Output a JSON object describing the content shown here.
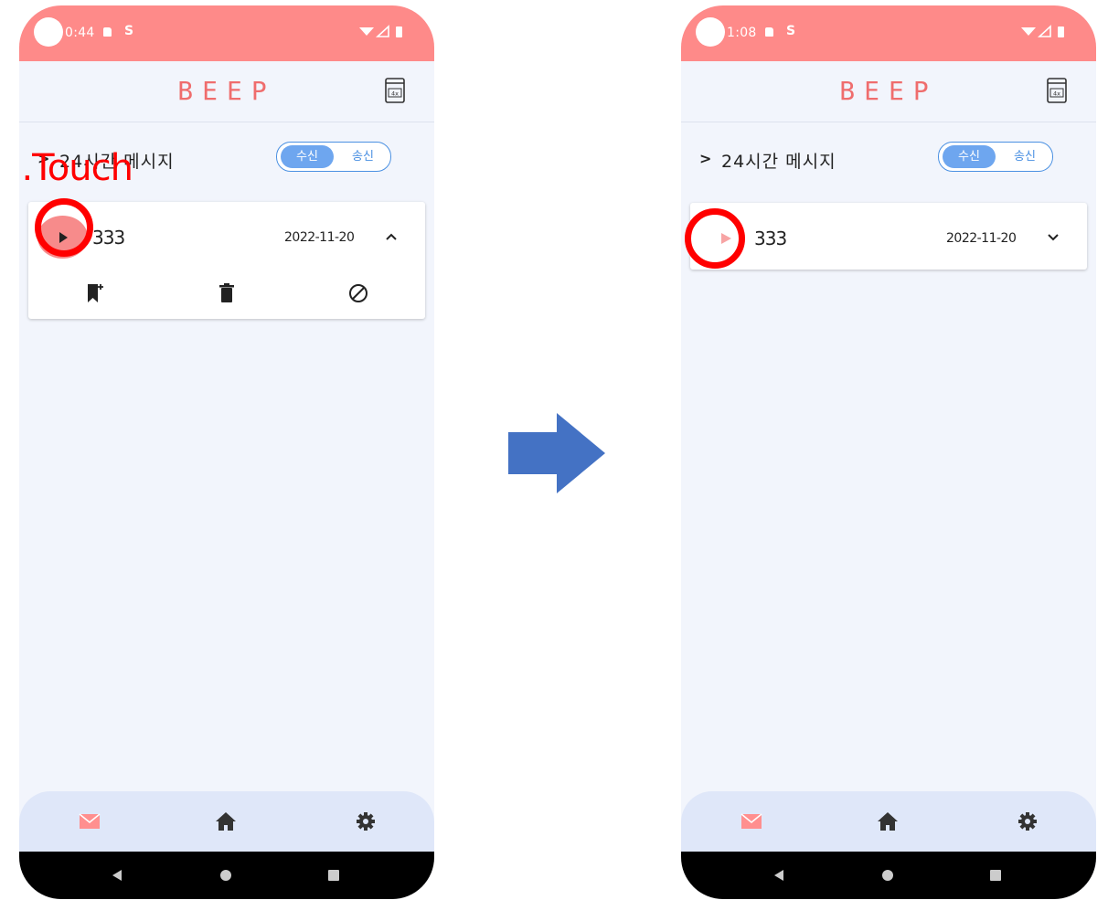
{
  "left_screen": {
    "status_time": "0:44",
    "status_s": "S",
    "app_logo": "BEEP",
    "section_title": "24시간 메시지",
    "toggle": {
      "received": "수신",
      "sent": "송신"
    },
    "message": {
      "caller": "333",
      "date": "2022-11-20",
      "expanded": true
    },
    "annotation": "1.Touch"
  },
  "right_screen": {
    "status_time": "1:08",
    "status_s": "S",
    "app_logo": "BEEP",
    "section_title": "24시간 메시지",
    "toggle": {
      "received": "수신",
      "sent": "송신"
    },
    "message": {
      "caller": "333",
      "date": "2022-11-20",
      "expanded": false
    }
  },
  "icons": {
    "header": "battery-4x-icon",
    "card_actions": [
      "bookmark-add-icon",
      "trash-icon",
      "block-icon"
    ],
    "bottom_nav": [
      "mail-icon",
      "home-icon",
      "settings-icon"
    ],
    "system_nav": [
      "back-icon",
      "home-circle-icon",
      "recent-apps-icon"
    ]
  },
  "colors": {
    "status_bar": "#fe8a89",
    "logo": "#ef6d6d",
    "toggle_accent": "#4a90e2",
    "annotation_red": "#ff0000",
    "transition_arrow": "#4472c4",
    "nav_active": "#ff8f8f"
  }
}
